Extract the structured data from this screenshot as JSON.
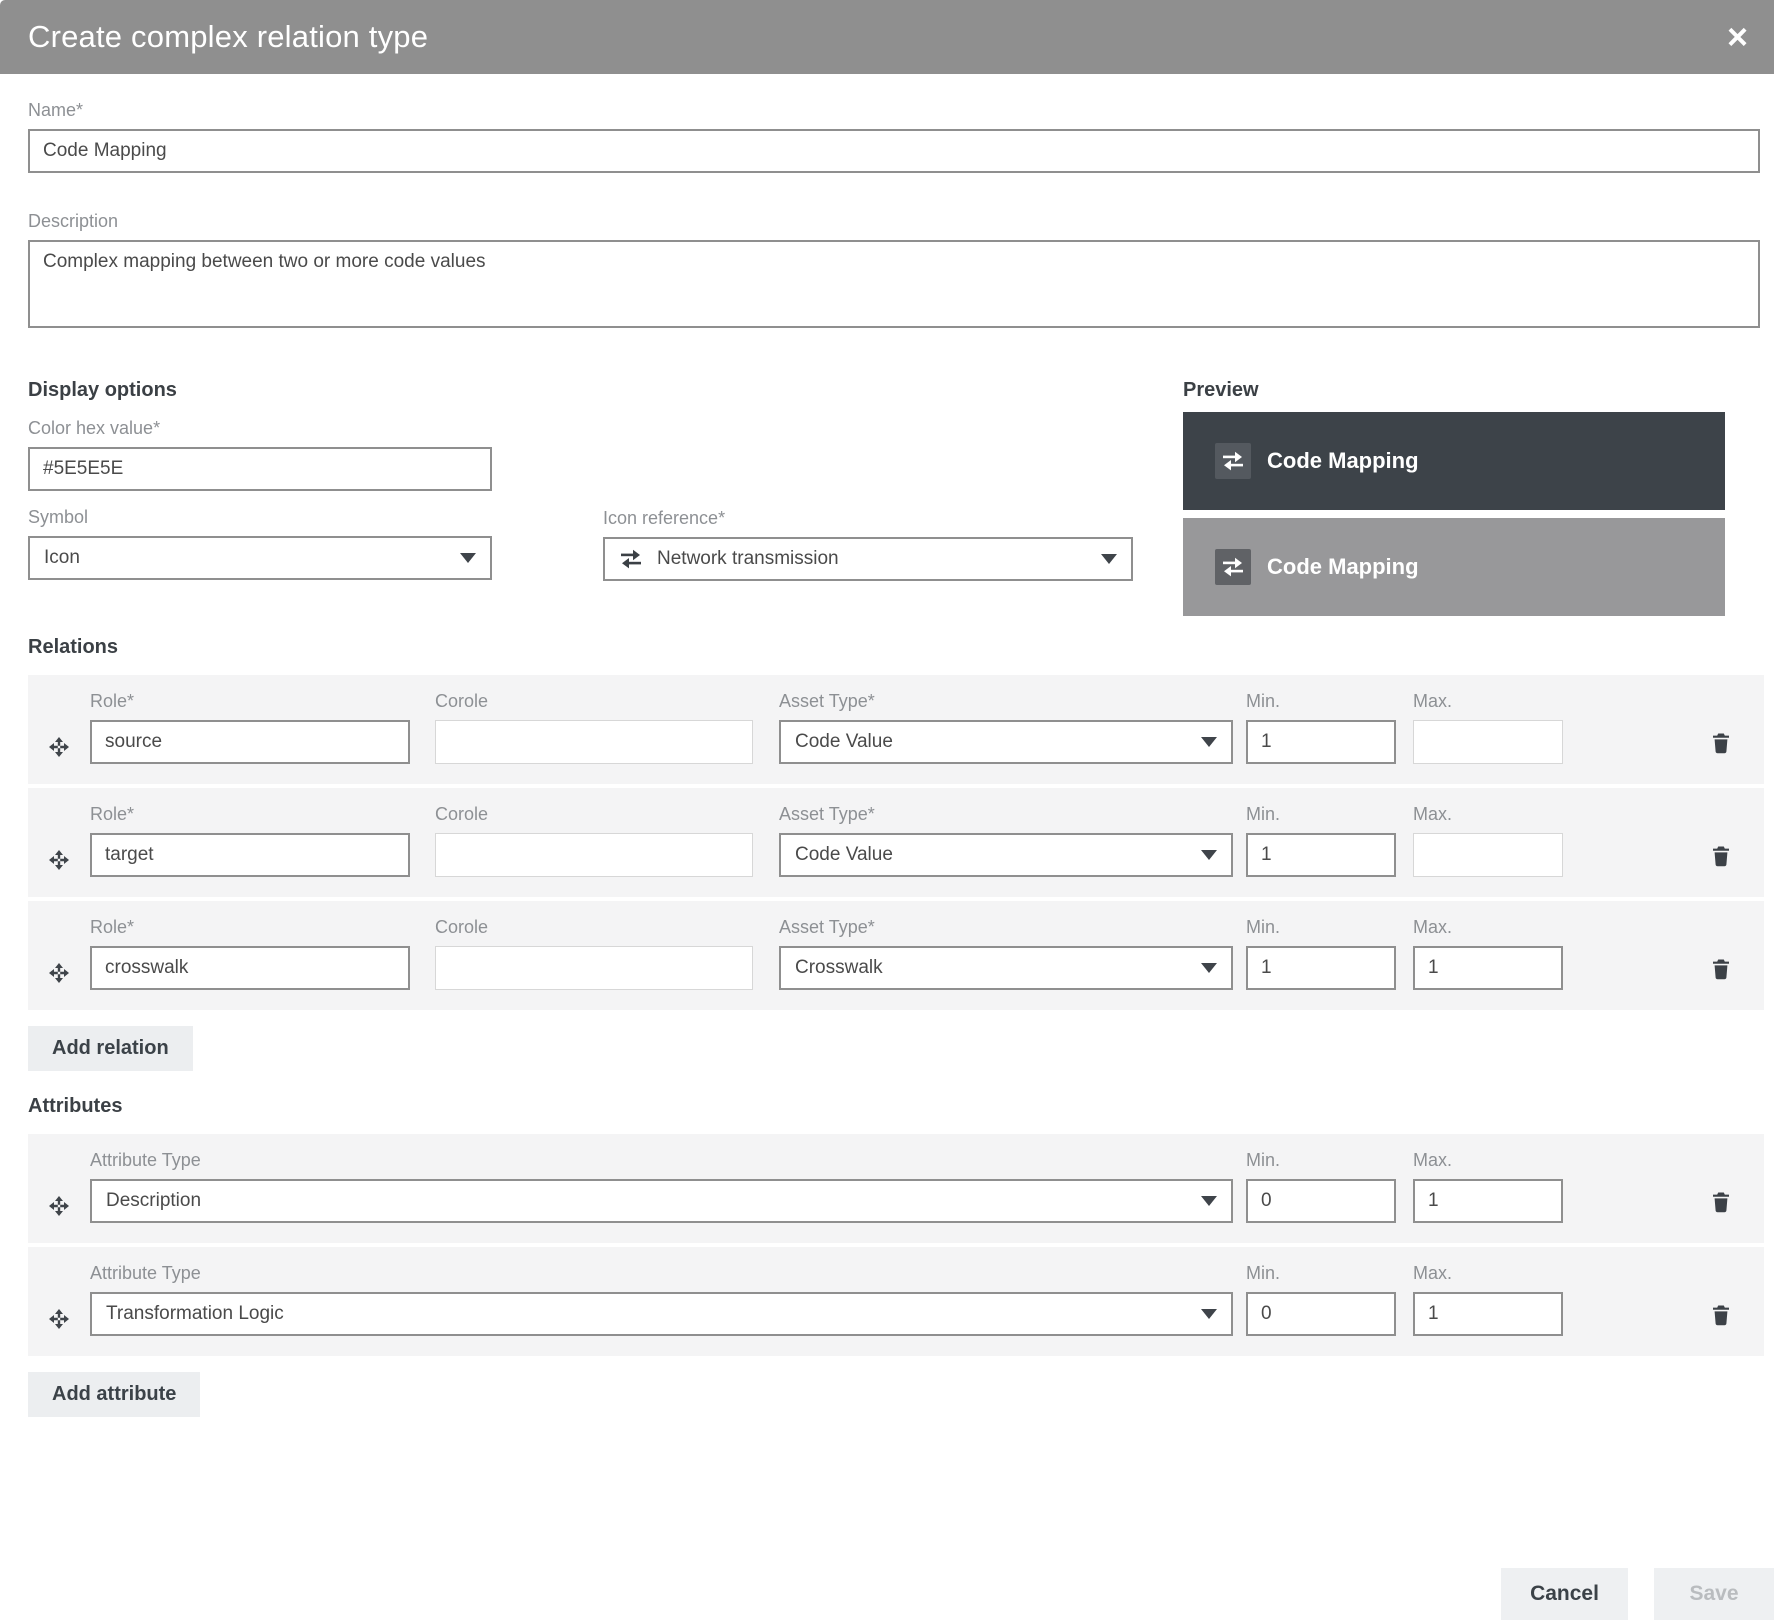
{
  "dialog": {
    "title": "Create complex relation type",
    "close_glyph": "×"
  },
  "fields": {
    "name": {
      "label": "Name*",
      "value": "Code Mapping"
    },
    "description": {
      "label": "Description",
      "value": "Complex mapping between two or more code values"
    }
  },
  "display_options": {
    "heading": "Display options",
    "color_hex": {
      "label": "Color hex value*",
      "value": "#5E5E5E"
    },
    "symbol": {
      "label": "Symbol",
      "value": "Icon"
    },
    "icon_reference": {
      "label": "Icon reference*",
      "value": "Network transmission",
      "icon": "swap-arrows"
    }
  },
  "preview": {
    "heading": "Preview",
    "items": [
      {
        "label": "Code Mapping",
        "bg": "#3D4349",
        "icon": "swap-arrows"
      },
      {
        "label": "Code Mapping",
        "bg": "#98989A",
        "icon": "swap-arrows"
      }
    ]
  },
  "relations": {
    "heading": "Relations",
    "add_button": "Add relation",
    "columns": {
      "role": "Role*",
      "corole": "Corole",
      "asset_type": "Asset Type*",
      "min": "Min.",
      "max": "Max."
    },
    "rows": [
      {
        "role": "source",
        "corole": "",
        "asset_type": "Code Value",
        "min": "1",
        "max": ""
      },
      {
        "role": "target",
        "corole": "",
        "asset_type": "Code Value",
        "min": "1",
        "max": ""
      },
      {
        "role": "crosswalk",
        "corole": "",
        "asset_type": "Crosswalk",
        "min": "1",
        "max": "1"
      }
    ]
  },
  "attributes": {
    "heading": "Attributes",
    "add_button": "Add attribute",
    "columns": {
      "attribute_type": "Attribute Type",
      "min": "Min.",
      "max": "Max."
    },
    "rows": [
      {
        "attribute_type": "Description",
        "min": "0",
        "max": "1"
      },
      {
        "attribute_type": "Transformation Logic",
        "min": "0",
        "max": "1"
      }
    ]
  },
  "footer": {
    "cancel": "Cancel",
    "save": "Save"
  },
  "icons": {
    "close": "x-close",
    "swap": "two-horizontal-swap-arrows",
    "move": "four-direction-move-crosshair",
    "trash": "trash-can",
    "caret": "caret-down-triangle"
  },
  "colors": {
    "header_bg": "#8F8F8F",
    "preview_dark_bg": "#3D4349",
    "preview_gray_bg": "#98989A",
    "row_bg": "#F4F4F5",
    "input_border": "#8F8F8F",
    "input_border_light": "#D7D7D7",
    "button_bg": "#ECEEF0",
    "heading_text": "#3B4045",
    "label_text": "#8D9094",
    "save_disabled_text": "#B9BCBF"
  }
}
